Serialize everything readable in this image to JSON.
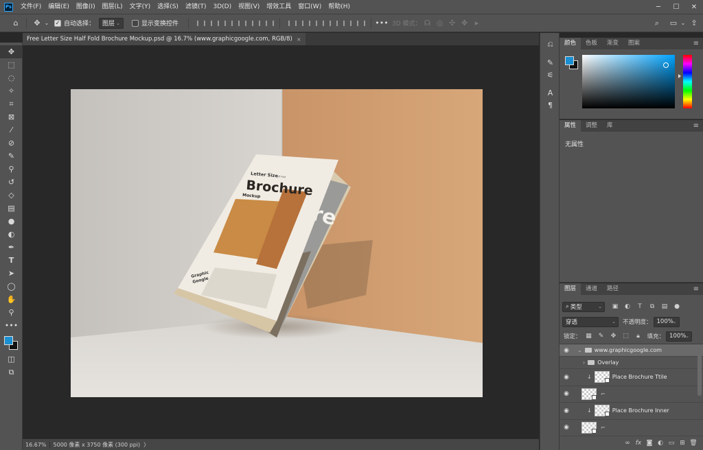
{
  "app": {
    "logo": "Ps"
  },
  "menu": [
    "文件(F)",
    "编辑(E)",
    "图像(I)",
    "图层(L)",
    "文字(Y)",
    "选择(S)",
    "滤镜(T)",
    "3D(D)",
    "视图(V)",
    "增效工具",
    "窗口(W)",
    "帮助(H)"
  ],
  "options": {
    "auto_select_label": "自动选择：",
    "auto_select_value": "图层",
    "show_transform_label": "显示变换控件",
    "mode_3d_label": "3D 模式："
  },
  "document": {
    "tab_title": "Free Letter Size Half Fold Brochure Mockup.psd @ 16.7% (www.graphicgoogle.com, RGB/8)",
    "close_glyph": "×"
  },
  "status": {
    "zoom": "16.67%",
    "info": "5000 像素 x 3750 像素 (300 ppi)",
    "arrow": "〉"
  },
  "mockup": {
    "kicker": "Letter Size",
    "kicker_small": "Half Fold",
    "title": "Brochure",
    "subtitle": "Mockup",
    "brand_line1": "Graphic",
    "brand_line2": "Google",
    "back_text": "re"
  },
  "colors": {
    "foreground": "#1a8fd1",
    "background": "#111111",
    "wall_left": "#d2cfca",
    "wall_right": "#d4a274",
    "floor": "#e2dfda"
  },
  "color_panel": {
    "tabs": [
      "颜色",
      "色板",
      "渐变",
      "图案"
    ]
  },
  "properties_panel": {
    "tabs": [
      "属性",
      "调整",
      "库"
    ],
    "empty_text": "无属性"
  },
  "layers_panel": {
    "tabs": [
      "图层",
      "通道",
      "路径"
    ],
    "filter_kind": "类型",
    "blend_mode": "穿透",
    "opacity_label": "不透明度：",
    "opacity_value": "100%",
    "lock_label": "锁定：",
    "fill_label": "填充：",
    "fill_value": "100%",
    "layers": [
      {
        "name": "www.graphicgoogle.com",
        "kind": "group"
      },
      {
        "name": "Overlay",
        "kind": "group"
      },
      {
        "name": "Place Brochure Ttile",
        "kind": "smart"
      },
      {
        "name": "",
        "kind": "layer"
      },
      {
        "name": "Place Brochure Inner",
        "kind": "smart"
      },
      {
        "name": "",
        "kind": "layer"
      }
    ]
  }
}
